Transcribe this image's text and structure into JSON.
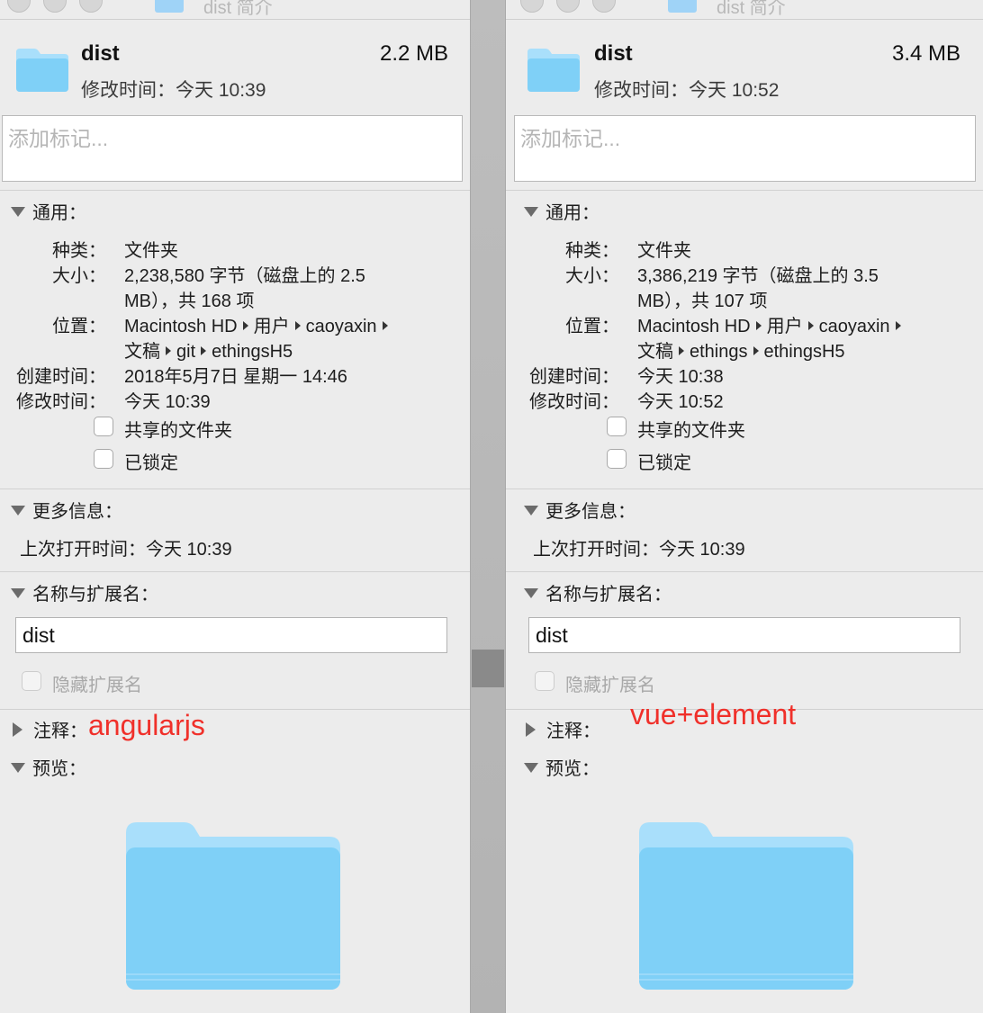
{
  "panels": [
    {
      "window_title": "dist 简介",
      "name": "dist",
      "size": "2.2 MB",
      "modified_header": "修改时间：今天 10:39",
      "tags_placeholder": "添加标记...",
      "general": {
        "header": "通用：",
        "kind_label": "种类：",
        "kind": "文件夹",
        "size_label": "大小：",
        "size_line1": "2,238,580 字节（磁盘上的 2.5",
        "size_line2": "MB），共 168 项",
        "location_label": "位置：",
        "location_line1": [
          "Macintosh HD",
          "用户",
          "caoyaxin",
          ""
        ],
        "location_line2": [
          "文稿",
          "git",
          "ethingsH5"
        ],
        "created_label": "创建时间：",
        "created": "2018年5月7日 星期一 14:46",
        "modified_label": "修改时间：",
        "modified": "今天 10:39",
        "shared_folder": "共享的文件夹",
        "locked": "已锁定"
      },
      "more_info": {
        "header": "更多信息：",
        "last_opened": "上次打开时间：今天 10:39"
      },
      "name_ext": {
        "header": "名称与扩展名：",
        "value": "dist",
        "hide_extension": "隐藏扩展名"
      },
      "comments": {
        "header": "注释：",
        "annotation": "angularjs"
      },
      "preview": {
        "header": "预览："
      }
    },
    {
      "window_title": "dist 简介",
      "name": "dist",
      "size": "3.4 MB",
      "modified_header": "修改时间：今天 10:52",
      "tags_placeholder": "添加标记...",
      "general": {
        "header": "通用：",
        "kind_label": "种类：",
        "kind": "文件夹",
        "size_label": "大小：",
        "size_line1": "3,386,219 字节（磁盘上的 3.5",
        "size_line2": "MB），共 107 项",
        "location_label": "位置：",
        "location_line1": [
          "Macintosh HD",
          "用户",
          "caoyaxin",
          ""
        ],
        "location_line2": [
          "文稿",
          "ethings",
          "ethingsH5"
        ],
        "created_label": "创建时间：",
        "created": "今天 10:38",
        "modified_label": "修改时间：",
        "modified": "今天 10:52",
        "shared_folder": "共享的文件夹",
        "locked": "已锁定"
      },
      "more_info": {
        "header": "更多信息：",
        "last_opened": "上次打开时间：今天 10:39"
      },
      "name_ext": {
        "header": "名称与扩展名：",
        "value": "dist",
        "hide_extension": "隐藏扩展名"
      },
      "comments": {
        "header": "注释：",
        "annotation": "vue+element"
      },
      "preview": {
        "header": "预览："
      }
    }
  ],
  "colors": {
    "folder": "#7fd0f7",
    "folder_tab": "#a9dffb",
    "annotation": "#f0302a"
  }
}
